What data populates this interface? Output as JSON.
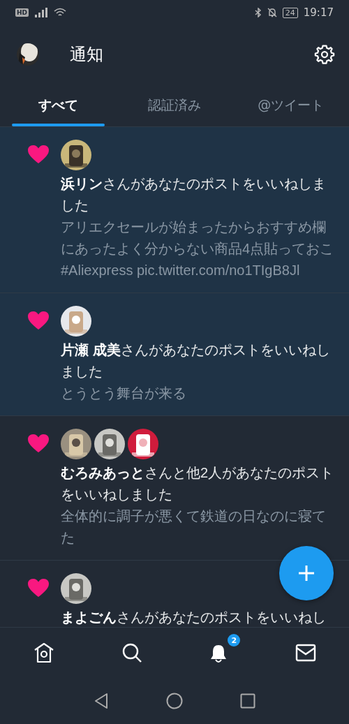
{
  "status_bar": {
    "network_badge": "HD",
    "battery": "24",
    "time": "19:17"
  },
  "header": {
    "title": "通知"
  },
  "tabs": [
    {
      "label": "すべて",
      "selected": true
    },
    {
      "label": "認証済み",
      "selected": false
    },
    {
      "label": "@ツイート",
      "selected": false
    }
  ],
  "notifications": [
    {
      "unread": true,
      "text": "**浜リン**さんがあなたのポストをいいねしました",
      "post": "アリエクセールが始まったからおすすめ欄にあったよく分からない商品4点貼っておこ #Aliexpress pic.twitter.com/no1TIgB8Jl"
    },
    {
      "unread": true,
      "text": "**片瀬 成美**さんがあなたのポストをいいねしました",
      "post": "とうとう舞台が来る"
    },
    {
      "unread": false,
      "text": "**むろみあっと**さんと他2人があなたのポストをいいねしました",
      "post": "全体的に調子が悪くて鉄道の日なのに寝てた"
    },
    {
      "unread": false,
      "text": "**まよごん**さんがあなたのポストをいいねし"
    }
  ],
  "bottom_nav": [
    {
      "kind": "home",
      "selected": false
    },
    {
      "kind": "search",
      "selected": false
    },
    {
      "kind": "bell",
      "selected": true,
      "badge": "2"
    },
    {
      "kind": "mail",
      "selected": false
    }
  ]
}
